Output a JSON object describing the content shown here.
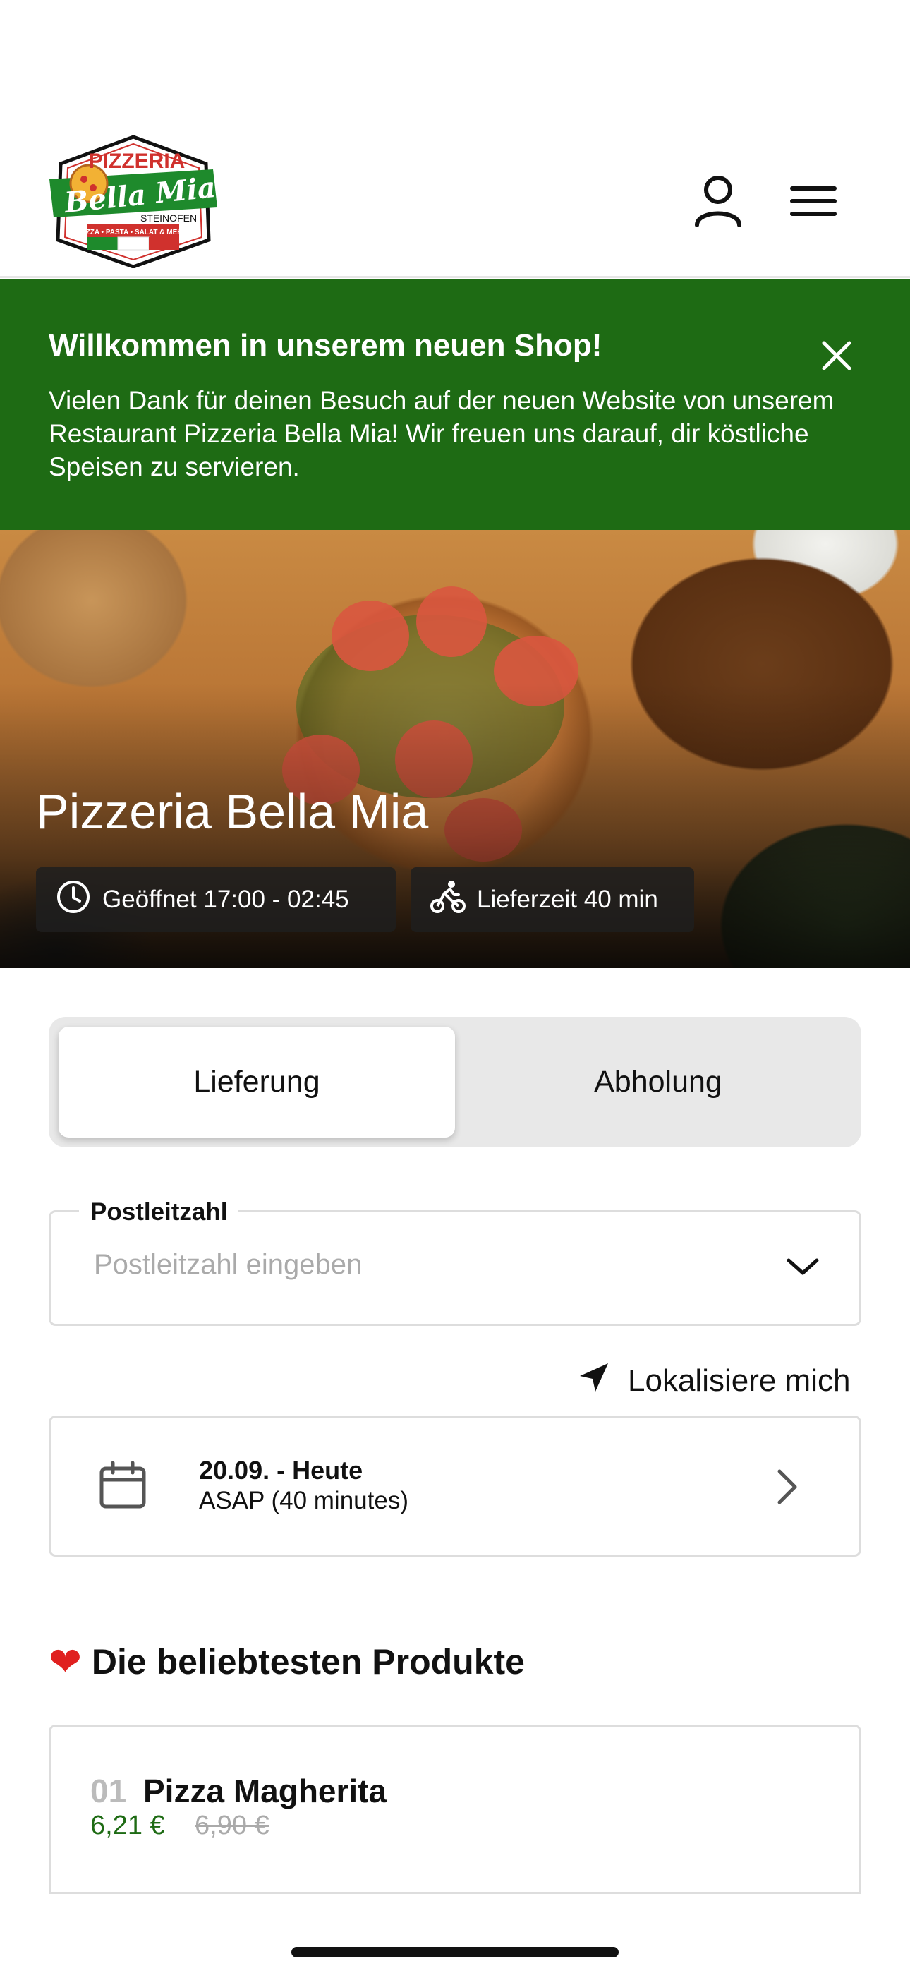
{
  "header": {
    "logo": {
      "top_text": "PIZZERIA",
      "name": "Bella Mia",
      "sub": "STEINOFEN",
      "tagline": "PIZZA • PASTA • SALAT & MEHR",
      "colors": {
        "green": "#1e8a2c",
        "red": "#d0312d"
      }
    },
    "icons": {
      "account": "user-icon",
      "menu": "hamburger-menu-icon"
    }
  },
  "banner": {
    "title": "Willkommen in unserem neuen Shop!",
    "text": "Vielen Dank für deinen Besuch auf der neuen Website von unserem Restaurant Pizzeria Bella Mia! Wir freuen uns darauf, dir köstliche Speisen zu servieren.",
    "close_icon": "close-icon",
    "color": "#1e6b14"
  },
  "hero": {
    "title": "Pizzeria Bella Mia",
    "opening": "Geöffnet 17:00 - 02:45",
    "delivery_time": "Lieferzeit 40 min"
  },
  "order_mode": {
    "options": [
      "Lieferung",
      "Abholung"
    ],
    "selected": "Lieferung"
  },
  "postcode": {
    "label": "Postleitzahl",
    "placeholder": "Postleitzahl eingeben",
    "value": ""
  },
  "locate": {
    "label": "Lokalisiere mich"
  },
  "schedule": {
    "date": "20.09. - Heute",
    "time": "ASAP (40 minutes)"
  },
  "popular": {
    "title": "Die beliebtesten Produkte",
    "items": [
      {
        "rank": "01",
        "name": "Pizza Magherita",
        "price": "6,21 €",
        "old_price": "6,90 €"
      }
    ]
  }
}
